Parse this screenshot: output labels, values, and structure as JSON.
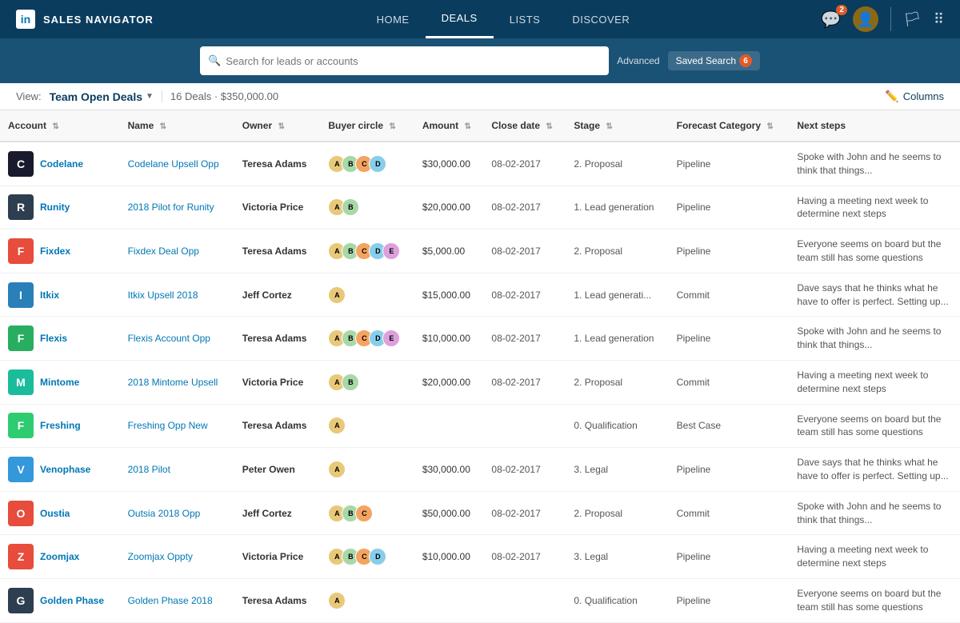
{
  "nav": {
    "logo_text": "SALES NAVIGATOR",
    "links": [
      {
        "label": "HOME",
        "active": false
      },
      {
        "label": "DEALS",
        "active": true
      },
      {
        "label": "LISTS",
        "active": false
      },
      {
        "label": "DISCOVER",
        "active": false
      }
    ],
    "notifications_count": "2",
    "saved_search_label": "Saved  Search",
    "saved_search_count": "6"
  },
  "search": {
    "placeholder": "Search for leads or accounts",
    "advanced_label": "Advanced",
    "saved_search_label": "Saved  Search"
  },
  "view_bar": {
    "view_label": "View:",
    "view_name": "Team Open Deals",
    "deals_count": "16 Deals · $350,000.00",
    "columns_label": "Columns"
  },
  "table": {
    "columns": [
      {
        "label": "Account",
        "sortable": true
      },
      {
        "label": "Name",
        "sortable": true
      },
      {
        "label": "Owner",
        "sortable": true
      },
      {
        "label": "Buyer circle",
        "sortable": true
      },
      {
        "label": "Amount",
        "sortable": true
      },
      {
        "label": "Close date",
        "sortable": true
      },
      {
        "label": "Stage",
        "sortable": true
      },
      {
        "label": "Forecast Category",
        "sortable": true
      },
      {
        "label": "Next steps",
        "sortable": false
      }
    ],
    "rows": [
      {
        "company": "Codelane",
        "logo_class": "logo-codelane",
        "logo_char": "C",
        "name": "Codelane Upsell Opp",
        "owner": "Teresa Adams",
        "buyer_count": 4,
        "amount": "$30,000.00",
        "close_date": "08-02-2017",
        "stage": "2. Proposal",
        "forecast": "Pipeline",
        "next_steps": "Spoke with John and he seems to think that things..."
      },
      {
        "company": "Runity",
        "logo_class": "logo-runity",
        "logo_char": "R",
        "name": "2018 Pilot for Runity",
        "owner": "Victoria Price",
        "buyer_count": 2,
        "amount": "$20,000.00",
        "close_date": "08-02-2017",
        "stage": "1. Lead generation",
        "forecast": "Pipeline",
        "next_steps": "Having a meeting next week to determine next steps"
      },
      {
        "company": "Fixdex",
        "logo_class": "logo-fixdex",
        "logo_char": "F",
        "name": "Fixdex Deal Opp",
        "owner": "Teresa Adams",
        "buyer_count": 5,
        "amount": "$5,000.00",
        "close_date": "08-02-2017",
        "stage": "2. Proposal",
        "forecast": "Pipeline",
        "next_steps": "Everyone seems on board but the team still has some questions"
      },
      {
        "company": "Itkix",
        "logo_class": "logo-itkix",
        "logo_char": "I",
        "name": "Itkix Upsell 2018",
        "owner": "Jeff Cortez",
        "buyer_count": 1,
        "amount": "$15,000.00",
        "close_date": "08-02-2017",
        "stage": "1. Lead generati...",
        "forecast": "Commit",
        "next_steps": "Dave says that he thinks what he have to offer is perfect. Setting up..."
      },
      {
        "company": "Flexis",
        "logo_class": "logo-flexis",
        "logo_char": "F",
        "name": "Flexis Account Opp",
        "owner": "Teresa Adams",
        "buyer_count": 5,
        "amount": "$10,000.00",
        "close_date": "08-02-2017",
        "stage": "1. Lead generation",
        "forecast": "Pipeline",
        "next_steps": "Spoke with John and he seems to think that things..."
      },
      {
        "company": "Mintome",
        "logo_class": "logo-mintome",
        "logo_char": "M",
        "name": "2018 Mintome Upsell",
        "owner": "Victoria Price",
        "buyer_count": 2,
        "amount": "$20,000.00",
        "close_date": "08-02-2017",
        "stage": "2. Proposal",
        "forecast": "Commit",
        "next_steps": "Having a meeting next week to determine next steps"
      },
      {
        "company": "Freshing",
        "logo_class": "logo-freshing",
        "logo_char": "F",
        "name": "Freshing Opp New",
        "owner": "Teresa Adams",
        "buyer_count": 1,
        "amount": "",
        "close_date": "",
        "stage": "0. Qualification",
        "forecast": "Best Case",
        "next_steps": "Everyone seems on board but the team still has some questions"
      },
      {
        "company": "Venophase",
        "logo_class": "logo-venophase",
        "logo_char": "V",
        "name": "2018 Pilot",
        "owner": "Peter Owen",
        "buyer_count": 1,
        "amount": "$30,000.00",
        "close_date": "08-02-2017",
        "stage": "3. Legal",
        "forecast": "Pipeline",
        "next_steps": "Dave says that he thinks what he have to offer is perfect. Setting up..."
      },
      {
        "company": "Oustia",
        "logo_class": "logo-oustia",
        "logo_char": "O",
        "name": "Outsia 2018 Opp",
        "owner": "Jeff Cortez",
        "buyer_count": 3,
        "amount": "$50,000.00",
        "close_date": "08-02-2017",
        "stage": "2. Proposal",
        "forecast": "Commit",
        "next_steps": "Spoke with John and he seems to think that things..."
      },
      {
        "company": "Zoomjax",
        "logo_class": "logo-zoomjax",
        "logo_char": "Z",
        "name": "Zoomjax Oppty",
        "owner": "Victoria Price",
        "buyer_count": 4,
        "amount": "$10,000.00",
        "close_date": "08-02-2017",
        "stage": "3. Legal",
        "forecast": "Pipeline",
        "next_steps": "Having a meeting next week to determine next steps"
      },
      {
        "company": "Golden Phase",
        "logo_class": "logo-goldenphase",
        "logo_char": "G",
        "name": "Golden Phase 2018",
        "owner": "Teresa Adams",
        "buyer_count": 1,
        "amount": "",
        "close_date": "",
        "stage": "0. Qualification",
        "forecast": "Pipeline",
        "next_steps": "Everyone seems on board but the team still has some questions"
      }
    ]
  }
}
